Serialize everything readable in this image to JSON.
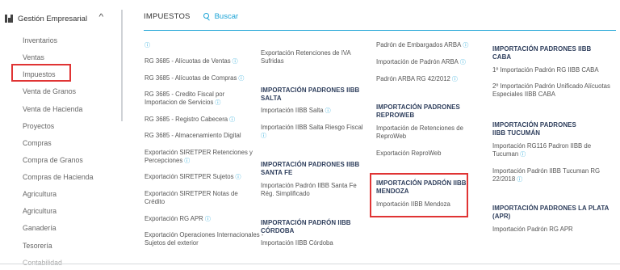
{
  "sidebar": {
    "header": "Gestión Empresarial",
    "items": [
      {
        "label": "Inventarios"
      },
      {
        "label": "Ventas"
      },
      {
        "label": "Impuestos"
      },
      {
        "label": "Venta de Granos"
      },
      {
        "label": "Venta de Hacienda"
      },
      {
        "label": "Proyectos"
      },
      {
        "label": "Compras"
      },
      {
        "label": "Compra de Granos"
      },
      {
        "label": "Compras de Hacienda"
      },
      {
        "label": "Agricultura"
      },
      {
        "label": "Agricultura"
      },
      {
        "label": "Ganadería"
      },
      {
        "label": "Tesorería"
      },
      {
        "label": "Contabilidad"
      }
    ],
    "selected": "Impuestos"
  },
  "tabs": {
    "active": "IMPUESTOS",
    "search": "Buscar"
  },
  "col1": [
    "RG 3685 - Alícuotas de Ventas",
    "RG 3685 - Alícuotas de Compras",
    "RG 3685 - Credito Fiscal por Importacion de Servicios",
    "RG 3685 - Registro Cabecera",
    "RG 3685 - Almacenamiento Digital",
    "Exportación SIRETPER Retenciones y Percepciones",
    "Exportación SIRETPER Sujetos",
    "Exportación SIRETPER Notas de Crédito",
    "Exportación RG APR",
    "Exportación Operaciones Internacionales - Sujetos del exterior"
  ],
  "col2": {
    "top_link": "Exportación Retenciones de IVA Sufridas",
    "salta_header": "IMPORTACIÓN PADRONES IIBB SALTA",
    "salta_links": [
      "Importación IIBB Salta",
      "Importación IIBB Salta Riesgo Fiscal"
    ],
    "santafe_header": "IMPORTACIÓN PADRONES IIBB SANTA FE",
    "santafe_links": [
      "Importación Padrón IIBB Santa Fe Rég. Simplificado"
    ],
    "cordoba_header": "IMPORTACIÓN PADRÓN IIBB CÓRDOBA",
    "cordoba_links": [
      "Importación IIBB Córdoba"
    ]
  },
  "col3": {
    "arba_links": [
      "Padrón de Embargados ARBA",
      "Importación de Padrón ARBA",
      "Padrón ARBA RG 42/2012"
    ],
    "reproweb_header": "IMPORTACIÓN PADRONES REPROWEB",
    "reproweb_links": [
      "Importación de Retenciones de ReproWeb",
      "Exportación ReproWeb"
    ],
    "mendoza_header": "IMPORTACIÓN PADRÓN IIBB MENDOZA",
    "mendoza_links": [
      "Importación IIBB Mendoza"
    ]
  },
  "col4": {
    "caba_header": "IMPORTACIÓN PADRONES IIBB CABA",
    "caba_links": [
      "1º Importación Padrón RG IIBB CABA",
      "2º Importación Padrón Unificado Alícuotas Especiales IIBB CABA"
    ],
    "tucuman_header": "IMPORTACIÓN PADRONES IIBB TUCUMÁN",
    "tucuman_links": [
      "Importación RG116 Padron IIBB de Tucuman",
      "Importación Padrón IIBB Tucuman RG 22/2018"
    ],
    "laplata_header": "IMPORTACIÓN PADRONES LA PLATA (APR)",
    "laplata_links": [
      "Importación Padrón RG APR"
    ]
  },
  "icons": {
    "info": "info-icon",
    "search": "search-icon",
    "menu": "grid-icon",
    "collapse": "chevron-up-icon"
  },
  "colors": {
    "accent": "#1aa3d6",
    "highlight": "#e03434",
    "header_text": "#2e3e5c"
  }
}
